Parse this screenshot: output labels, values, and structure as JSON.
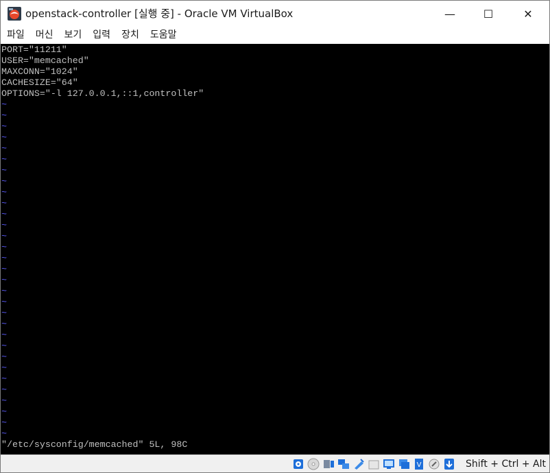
{
  "window": {
    "title": "openstack-controller [실행 중] - Oracle VM VirtualBox",
    "minimize_glyph": "—",
    "maximize_glyph": "☐",
    "close_glyph": "✕"
  },
  "menu": {
    "items": [
      "파일",
      "머신",
      "보기",
      "입력",
      "장치",
      "도움말"
    ]
  },
  "console": {
    "lines": [
      "PORT=\"11211\"",
      "USER=\"memcached\"",
      "MAXCONN=\"1024\"",
      "CACHESIZE=\"64\"",
      "OPTIONS=\"-l 127.0.0.1,::1,controller\""
    ],
    "tilde": "~",
    "status_line": "\"/etc/sysconfig/memcached\" 5L, 98C",
    "fg_color": "#c0c0c0",
    "tilde_color": "#5c5cff",
    "bg_color": "#000000"
  },
  "statusbar": {
    "icons": [
      "hard-disk-icon",
      "optical-drive-icon",
      "audio-icon",
      "network-icon",
      "usb-icon",
      "shared-folders-icon",
      "display-icon",
      "video-capture-icon",
      "cpu-icon",
      "virtualization-icon",
      "mouse-integration-icon",
      "keyboard-capture-icon"
    ],
    "host_key": "Shift + Ctrl + Alt"
  }
}
